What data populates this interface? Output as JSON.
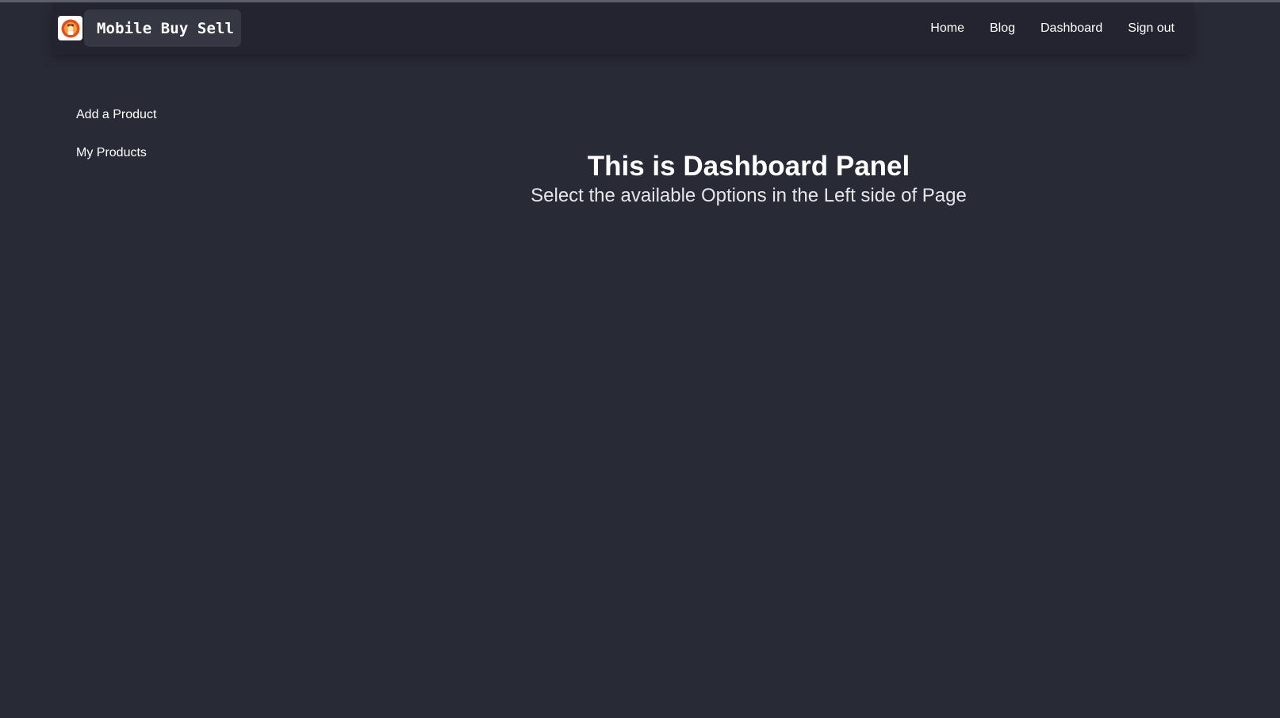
{
  "brand": {
    "name": "Mobile Buy Sell",
    "logo_icon": "avatar-logo-icon"
  },
  "nav": {
    "links": [
      "Home",
      "Blog",
      "Dashboard",
      "Sign out"
    ]
  },
  "sidebar": {
    "items": [
      {
        "label": "Add a Product"
      },
      {
        "label": "My Products"
      }
    ]
  },
  "main": {
    "title": "This is Dashboard Panel",
    "subtitle": "Select the available Options in the Left side of Page"
  },
  "colors": {
    "background": "#282a36",
    "navbar": "#232430",
    "brand_button": "#353743",
    "logo_accent": "#e2501c"
  }
}
